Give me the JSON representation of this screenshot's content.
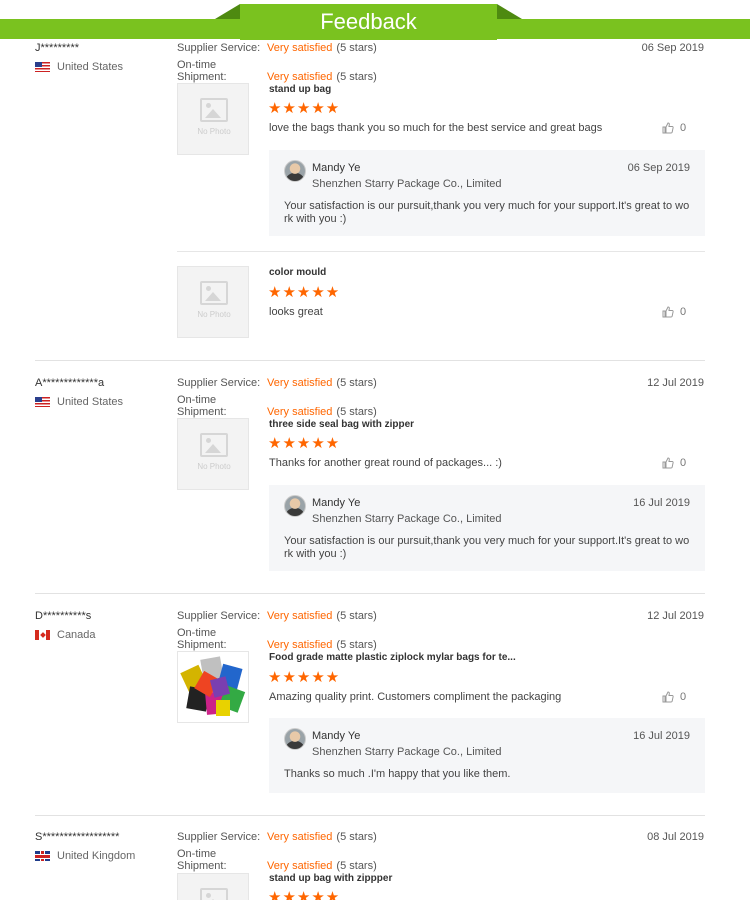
{
  "header": {
    "title": "Feedback"
  },
  "labels": {
    "supplier_service": "Supplier Service:",
    "ontime_shipment": "On-time Shipment:",
    "no_photo": "No Photo"
  },
  "colors": {
    "accent_green": "#7ac21f",
    "rating_orange": "#ff6600"
  },
  "reviews": [
    {
      "buyer": "J*********",
      "country": "United States",
      "flag": "us-flag-icon",
      "supplier_service": "Very satisfied",
      "supplier_service_stars": "(5 stars)",
      "ontime_shipment": "Very satisfied",
      "ontime_shipment_stars": "(5 stars)",
      "date": "06 Sep 2019",
      "items": [
        {
          "product": "stand up bag",
          "rating": 5,
          "stars": "★★★★★",
          "comment": "love the bags thank you so much for the best service and great bags",
          "likes": "0",
          "reply": {
            "name": "Mandy Ye",
            "company": "Shenzhen Starry Package Co., Limited",
            "date": "06 Sep 2019",
            "text": "Your satisfaction is our pursuit,thank you very much for your support.It's great to work with you :)"
          }
        },
        {
          "product": "color mould",
          "rating": 5,
          "stars": "★★★★★",
          "comment": "looks great",
          "likes": "0"
        }
      ]
    },
    {
      "buyer": "A*************a",
      "country": "United States",
      "flag": "us-flag-icon",
      "supplier_service": "Very satisfied",
      "supplier_service_stars": "(5 stars)",
      "ontime_shipment": "Very satisfied",
      "ontime_shipment_stars": "(5 stars)",
      "date": "12 Jul 2019",
      "items": [
        {
          "product": "three side seal bag with zipper",
          "rating": 5,
          "stars": "★★★★★",
          "comment": "Thanks for another great round of packages... :)",
          "likes": "0",
          "reply": {
            "name": "Mandy Ye",
            "company": "Shenzhen Starry Package Co., Limited",
            "date": "16 Jul 2019",
            "text": "Your satisfaction is our pursuit,thank you very much for your support.It's great to work with you :)"
          }
        }
      ]
    },
    {
      "buyer": "D**********s",
      "country": "Canada",
      "flag": "ca-flag-icon",
      "supplier_service": "Very satisfied",
      "supplier_service_stars": "(5 stars)",
      "ontime_shipment": "Very satisfied",
      "ontime_shipment_stars": "(5 stars)",
      "date": "12 Jul 2019",
      "items": [
        {
          "product": "Food grade matte plastic ziplock mylar bags for te...",
          "rating": 5,
          "stars": "★★★★★",
          "comment": "Amazing quality print. Customers compliment the packaging",
          "likes": "0",
          "reply": {
            "name": "Mandy Ye",
            "company": "Shenzhen Starry Package Co., Limited",
            "date": "16 Jul 2019",
            "text": "Thanks so much .I'm happy that you like them."
          }
        }
      ]
    },
    {
      "buyer": "S******************",
      "country": "United Kingdom",
      "flag": "gb-flag-icon",
      "supplier_service": "Very satisfied",
      "supplier_service_stars": "(5 stars)",
      "ontime_shipment": "Very satisfied",
      "ontime_shipment_stars": "(5 stars)",
      "date": "08 Jul 2019",
      "items": [
        {
          "product": "stand up bag with zippper",
          "rating": 5,
          "stars": "★★★★★"
        }
      ]
    }
  ]
}
